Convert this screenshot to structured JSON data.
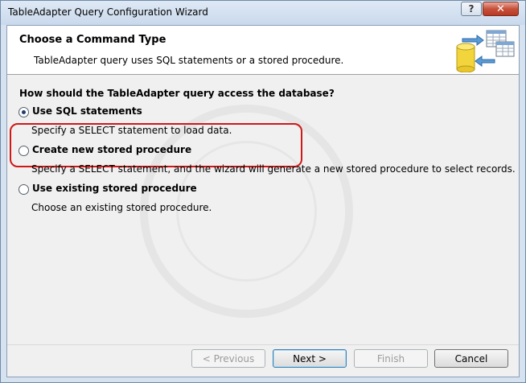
{
  "window": {
    "title": "TableAdapter Query Configuration Wizard",
    "help_label": "?",
    "close_label": "✕"
  },
  "header": {
    "title": "Choose a Command Type",
    "description": "TableAdapter query uses SQL statements or a stored procedure."
  },
  "body": {
    "question": "How should the TableAdapter query access the database?",
    "options": [
      {
        "label": "Use SQL statements",
        "description": "Specify a SELECT statement to load data.",
        "selected": true
      },
      {
        "label": "Create new stored procedure",
        "description": "Specify a SELECT statement, and the wizard will generate a new stored procedure to select records.",
        "selected": false
      },
      {
        "label": "Use existing stored procedure",
        "description": "Choose an existing stored procedure.",
        "selected": false
      }
    ]
  },
  "buttons": {
    "previous": "< Previous",
    "next": "Next >",
    "finish": "Finish",
    "cancel": "Cancel"
  },
  "icons": {
    "wizard": "database-table-exchange-icon"
  },
  "colors": {
    "highlight_border": "#d01818",
    "radio_dot": "#1f3e70"
  }
}
